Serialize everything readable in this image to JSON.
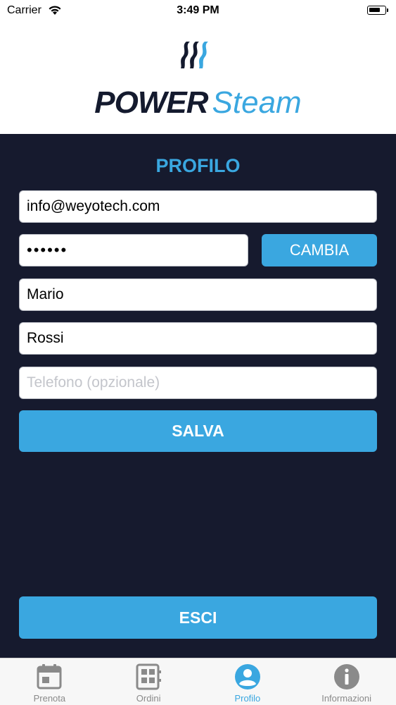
{
  "status_bar": {
    "carrier": "Carrier",
    "time": "3:49 PM"
  },
  "logo": {
    "word_power": "POWER",
    "word_steam": "Steam",
    "colors": {
      "dark": "#141a2e",
      "accent": "#3aa7e0"
    }
  },
  "profile": {
    "title": "PROFILO",
    "email_value": "info@weyotech.com",
    "password_value": "••••••",
    "change_button_label": "CAMBIA",
    "first_name_value": "Mario",
    "last_name_value": "Rossi",
    "phone_placeholder": "Telefono (opzionale)",
    "save_button_label": "SALVA",
    "logout_button_label": "ESCI"
  },
  "tabs": [
    {
      "label": "Prenota",
      "icon": "calendar-icon",
      "active": false
    },
    {
      "label": "Ordini",
      "icon": "orders-icon",
      "active": false
    },
    {
      "label": "Profilo",
      "icon": "user-icon",
      "active": true
    },
    {
      "label": "Informazioni",
      "icon": "info-icon",
      "active": false
    }
  ],
  "colors": {
    "panel_background": "#161a2e",
    "accent": "#3aa7e0",
    "tab_inactive": "#8a8a8a"
  }
}
